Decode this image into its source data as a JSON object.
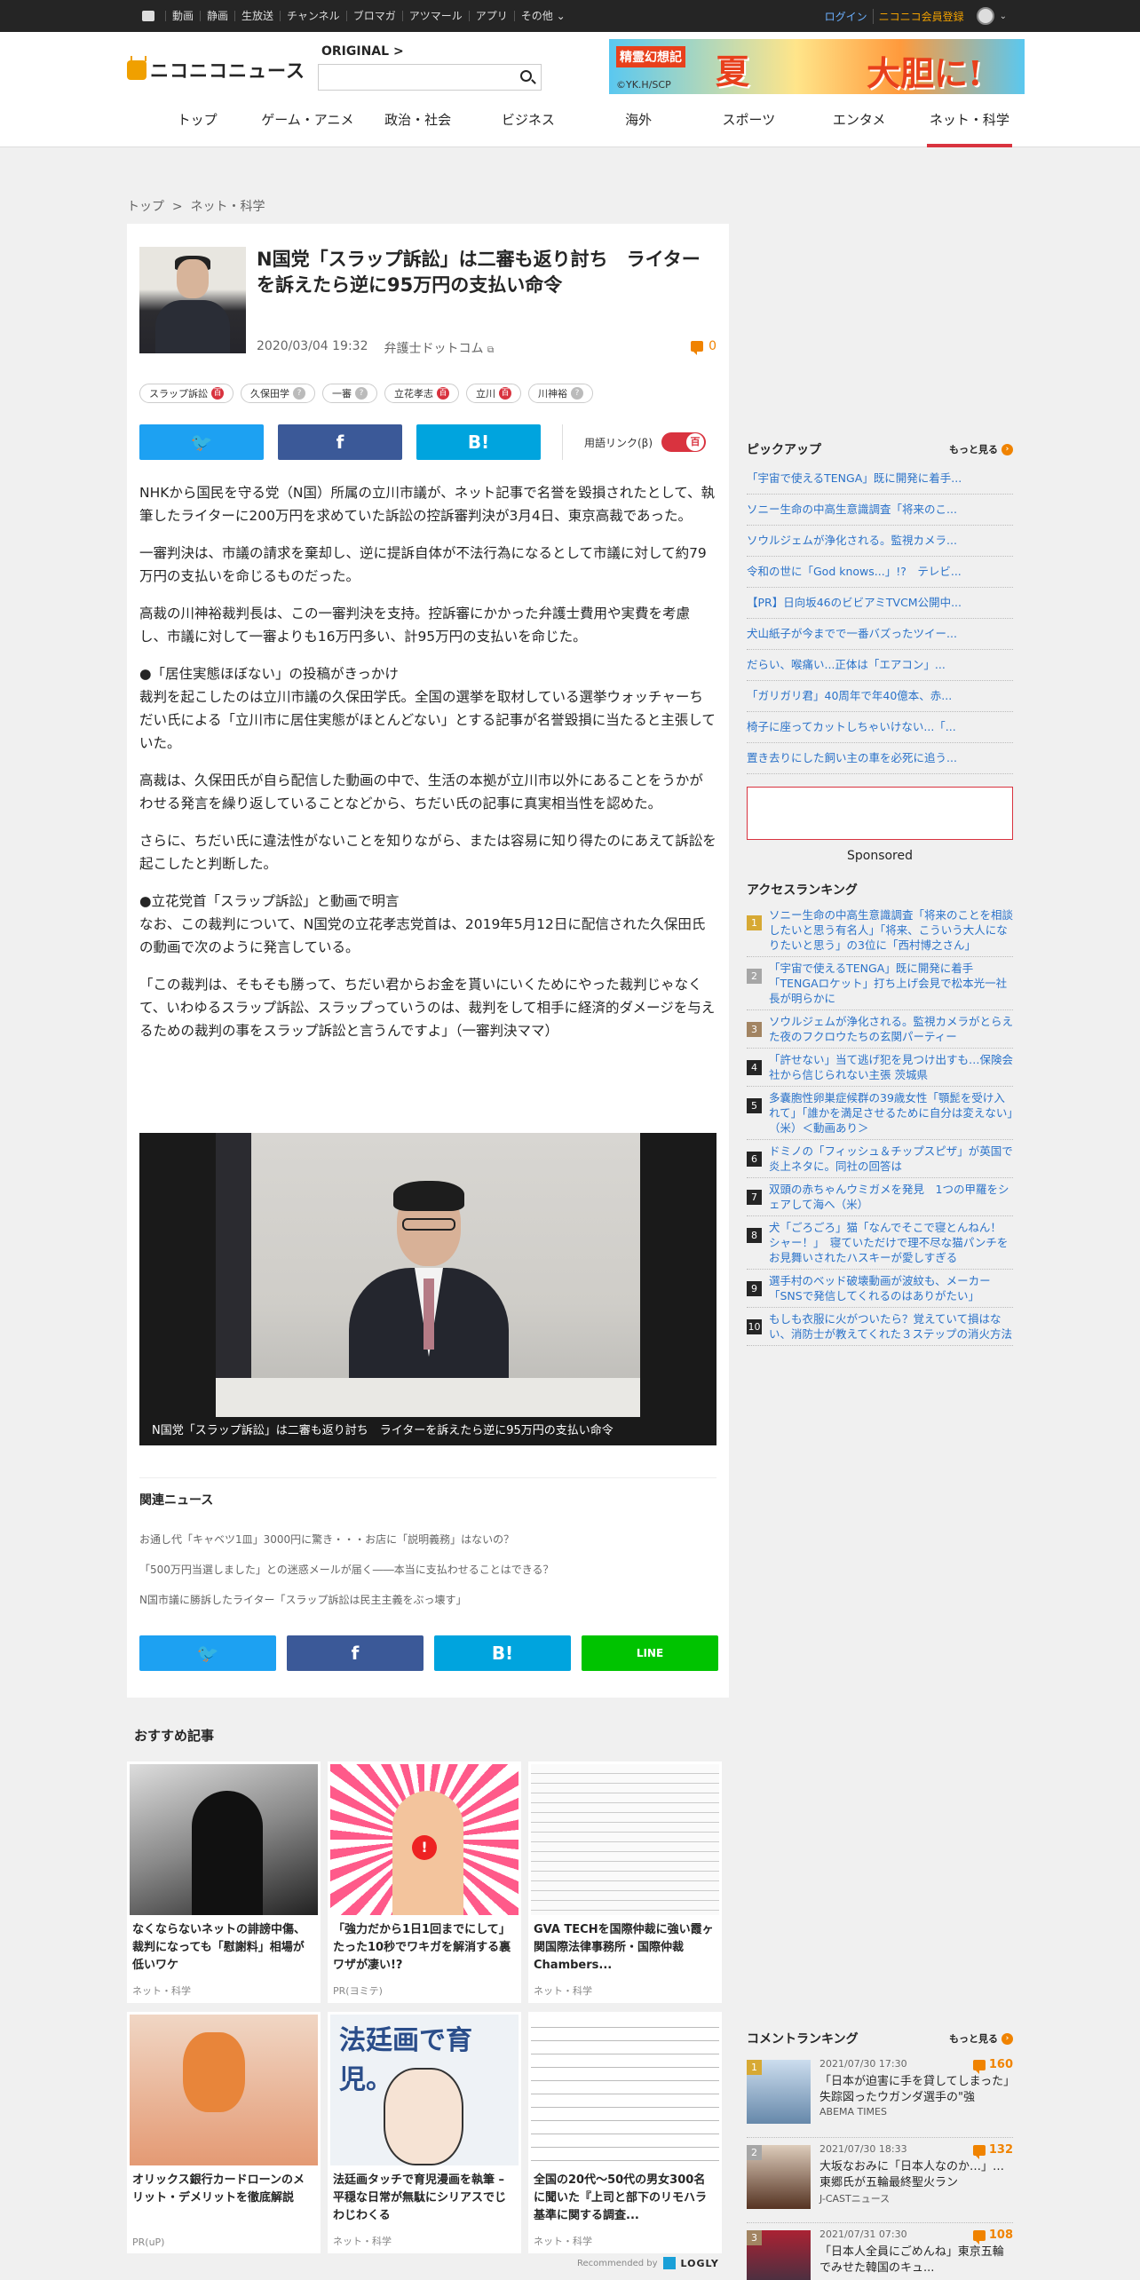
{
  "topbar": {
    "items": [
      "動画",
      "静画",
      "生放送",
      "チャンネル",
      "ブロマガ",
      "アツマール",
      "アプリ",
      "その他"
    ],
    "login": "ログイン",
    "register": "ニコニコ会員登録"
  },
  "header": {
    "logo": "ニコニコニュース",
    "original": "ORIGINAL",
    "search_placeholder": "",
    "banner": {
      "small": "精霊幻想記",
      "big1": "夏",
      "big2": "大胆に!",
      "credit": "©YK.H/SCP"
    }
  },
  "gnav": [
    "トップ",
    "ゲーム・アニメ",
    "政治・社会",
    "ビジネス",
    "海外",
    "スポーツ",
    "エンタメ",
    "ネット・科学"
  ],
  "breadcrumb": [
    "トップ",
    ">",
    "ネット・科学"
  ],
  "article": {
    "title": "N国党「スラップ訴訟」は二審も返り討ち　ライターを訴えたら逆に95万円の支払い命令",
    "date": "2020/03/04 19:32",
    "source": "弁護士ドットコム",
    "comment_count": "0",
    "tags": [
      "スラップ訴訟",
      "久保田学",
      "一審",
      "立花孝志",
      "立川",
      "川神裕"
    ],
    "yogo_label": "用語リンク(β)",
    "paragraphs": [
      "NHKから国民を守る党（N国）所属の立川市議が、ネット記事で名誉を毀損されたとして、執筆したライターに200万円を求めていた訴訟の控訴審判決が3月4日、東京高裁であった。",
      "一審判決は、市議の請求を棄却し、逆に提訴自体が不法行為になるとして市議に対して約79万円の支払いを命じるものだった。",
      "高裁の川神裕裁判長は、この一審判決を支持。控訴審にかかった弁護士費用や実費を考慮し、市議に対して一審よりも16万円多い、計95万円の支払いを命じた。",
      "●「居住実態ほぼない」の投稿がきっかけ\n裁判を起こしたのは立川市議の久保田学氏。全国の選挙を取材している選挙ウォッチャーちだい氏による「立川市に居住実態がほとんどない」とする記事が名誉毀損に当たると主張していた。",
      "高裁は、久保田氏が自ら配信した動画の中で、生活の本拠が立川市以外にあることをうかがわせる発言を繰り返していることなどから、ちだい氏の記事に真実相当性を認めた。",
      "さらに、ちだい氏に違法性がないことを知りながら、または容易に知り得たのにあえて訴訟を起こしたと判断した。",
      "●立花党首「スラップ訴訟」と動画で明言\nなお、この裁判について、N国党の立花孝志党首は、2019年5月12日に配信された久保田氏の動画で次のように発言している。",
      "「この裁判は、そもそも勝って、ちだい君からお金を貰いにいくためにやった裁判じゃなくて、いわゆるスラップ訴訟、スラップっていうのは、裁判をして相手に経済的ダメージを与えるための裁判の事をスラップ訴訟と言うんですよ」（一審判決ママ）"
    ],
    "photo_caption": "N国党「スラップ訴訟」は二審も返り討ち　ライターを訴えたら逆に95万円の支払い命令"
  },
  "related": {
    "heading": "関連ニュース",
    "items": [
      "お通し代「キャベツ1皿」3000円に驚き・・・お店に「説明義務」はないの？",
      "「500万円当選しました」との迷惑メールが届く――本当に支払わせることはできる？",
      "N国市議に勝訴したライター「スラップ訴訟は民主主義をぶっ壊す」"
    ]
  },
  "recommend": {
    "heading": "おすすめ記事",
    "cards": [
      {
        "title": "なくならないネットの誹謗中傷、裁判になっても「慰謝料」相場が低いワケ",
        "source": "ネット・科学"
      },
      {
        "title": "「強力だから1日1回までにして」たった10秒でワキガを解消する裏ワザが凄い!?",
        "source": "PR(ヨミテ)"
      },
      {
        "title": "GVA TECHを国際仲裁に強い霞ヶ関国際法律事務所・国際仲裁Chambers...",
        "source": "ネット・科学"
      },
      {
        "title": "オリックス銀行カードローンのメリット・デメリットを徹底解説",
        "source": "PR(uP)"
      },
      {
        "title": "法廷画タッチで育児漫画を執筆 – 平穏な日常が無駄にシリアスでじわじわくる",
        "source": "ネット・科学"
      },
      {
        "title": "全国の20代～50代の男女300名に聞いた『上司と部下のリモハラ基準に関する調査...",
        "source": "ネット・科学"
      }
    ],
    "card2_text": "法廷画で育児。",
    "recommended_by": "Recommended by",
    "logly": "LOGLY"
  },
  "sidebar": {
    "pickup_heading": "ピックアップ",
    "more": "もっと見る",
    "pickup": [
      "「宇宙で使えるTENGA」既に開発に着手...",
      "ソニー生命の中高生意識調査「将来のこ...",
      "ソウルジェムが浄化される。監視カメラ...",
      "令和の世に「God knows...」!?　テレビ...",
      "【PR】日向坂46のビビアミTVCM公開中...",
      "犬山紙子が今までで一番バズったツイー...",
      "だらい、喉痛い...正体は「エアコン」...",
      "「ガリガリ君」40周年で年40億本、赤...",
      "椅子に座ってカットしちゃいけない...「...",
      "置き去りにした飼い主の車を必死に追う..."
    ],
    "sponsored": "Sponsored",
    "access_heading": "アクセスランキング",
    "access": [
      "ソニー生命の中高生意識調査「将来のことを相談したいと思う有名人」「将来、こういう大人になりたいと思う」の3位に「西村博之さん」",
      "「宇宙で使えるTENGA」既に開発に着手　「TENGAロケット」打ち上げ会見で松本光一社長が明らかに",
      "ソウルジェムが浄化される。監視カメラがとらえた夜のフクロウたちの玄関パーティー",
      "「許せない」当て逃げ犯を見つけ出すも…保険会社から信じられない主張 茨城県",
      "多囊胞性卵巣症候群の39歳女性「顎髭を受け入れて」「誰かを満足させるために自分は変えない」（米）＜動画あり＞",
      "ドミノの「フィッシュ＆チップスピザ」が英国で炎上ネタに。同社の回答は",
      "双頭の赤ちゃんウミガメを発見　1つの甲羅をシェアして海へ（米）",
      "犬「ごろごろ」猫「なんでそこで寝とんねん！　シャー！」　寝ていただけで理不尽な猫パンチをお見舞いされたハスキーが愛しすぎる",
      "選手村のベッド破壊動画が波紋も、メーカー「SNSで発信してくれるのはありがたい」",
      "もしも衣服に火がついたら？覚えていて損はない、消防士が教えてくれた３ステップの消火方法"
    ],
    "comment_heading": "コメントランキング",
    "comment_rank": [
      {
        "n": "1",
        "date": "2021/07/30 17:30",
        "count": "160",
        "title": "「日本が迫害に手を貸してしまった」失踪図ったウガンダ選手の\"強",
        "source": "ABEMA TIMES"
      },
      {
        "n": "2",
        "date": "2021/07/30 18:33",
        "count": "132",
        "title": "大坂なおみに「日本人なのか…」…東郷氏が五輪最終聖火ラン",
        "source": "J-CASTニュース"
      },
      {
        "n": "3",
        "date": "2021/07/31 07:30",
        "count": "108",
        "title": "「日本人全員にごめんね」東京五輪でみせた韓国のキュ...",
        "source": ""
      }
    ]
  },
  "colors": {
    "accent_red": "#d9333f",
    "orange": "#f08300",
    "link_blue": "#2a72c9",
    "twitter": "#1da1f2",
    "facebook": "#3b5998",
    "hatena": "#00a4de",
    "line": "#00c300"
  }
}
